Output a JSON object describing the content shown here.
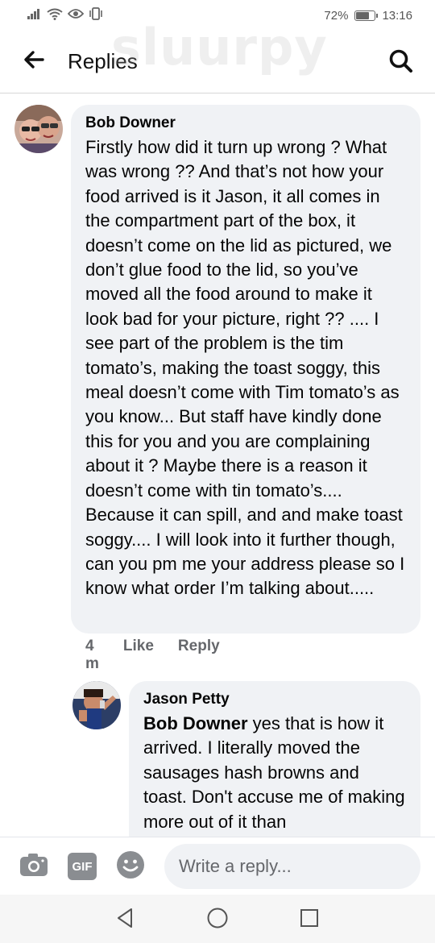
{
  "status_bar": {
    "battery": "72%",
    "battery_level": 0.72,
    "time": "13:16",
    "icons": [
      "signal-icon",
      "wifi-icon",
      "eye-icon",
      "vibrate-icon"
    ]
  },
  "header": {
    "title": "Replies",
    "back_icon": "arrow-left-icon",
    "search_icon": "search-icon"
  },
  "watermark": "sluurpy",
  "comments": [
    {
      "author": "Bob Downer",
      "text": "Firstly how did it turn up wrong ? What was wrong ??  And that’s not how your food arrived is it Jason, it all comes in the compartment part of the box, it doesn’t come on the lid as pictured, we don’t glue food to the lid, so you’ve moved all the food around to make it look bad for your picture, right ?? .... I see part of the problem is the tim tomato’s, making the toast soggy, this meal doesn’t come with Tim tomato’s as you know... But staff have kindly done this for you and you are complaining about it ? Maybe there is a reason it doesn’t come with tin tomato’s.... Because it can spill, and and make toast soggy.... I will look into it further though, can you pm me your address please so I know what order I’m talking about.....",
      "time": "4 m",
      "like": "Like",
      "reply": "Reply"
    },
    {
      "author": "Jason Petty",
      "mention": "Bob Downer",
      "text": " yes that is how it arrived. I literally moved the sausages hash browns and toast. Don't accuse me of making more out of it than"
    }
  ],
  "composer": {
    "placeholder": "Write a reply...",
    "icons": [
      "camera-icon",
      "gif-icon",
      "emoji-icon"
    ],
    "gif_label": "GIF"
  },
  "navbar": {
    "icons": [
      "back-triangle-icon",
      "home-circle-icon",
      "recents-square-icon"
    ]
  }
}
